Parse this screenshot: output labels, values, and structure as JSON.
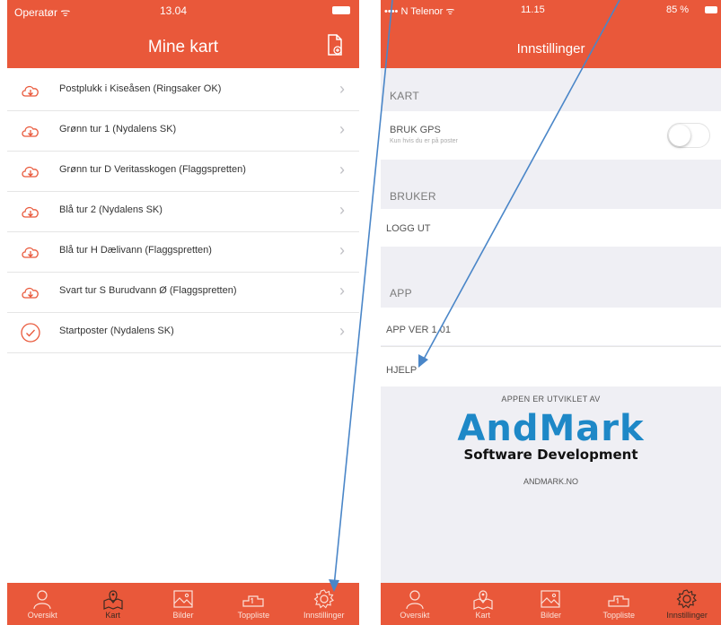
{
  "left_screen": {
    "status": {
      "carrier": "Operatør ᯤ",
      "time": "13.04"
    },
    "title": "Mine kart",
    "new_map_icon": "new-document-icon",
    "rows": [
      {
        "label": "Postplukk i Kiseåsen (Ringsaker OK)",
        "icon": "cloud-download-icon"
      },
      {
        "label": "Grønn tur 1 (Nydalens SK)",
        "icon": "cloud-download-icon"
      },
      {
        "label": "Grønn tur D Veritasskogen (Flaggspretten)",
        "icon": "cloud-download-icon"
      },
      {
        "label": "Blå tur 2 (Nydalens SK)",
        "icon": "cloud-download-icon"
      },
      {
        "label": "Blå tur H Dælivann (Flaggspretten)",
        "icon": "cloud-download-icon"
      },
      {
        "label": "Svart tur S Burudvann Ø (Flaggspretten)",
        "icon": "cloud-download-icon"
      },
      {
        "label": "Startposter (Nydalens SK)",
        "icon": "check-circle-icon"
      }
    ],
    "chevron": "›",
    "tabs": [
      {
        "label": "Oversikt",
        "icon": "person-icon"
      },
      {
        "label": "Kart",
        "icon": "map-pin-icon"
      },
      {
        "label": "Bilder",
        "icon": "image-icon"
      },
      {
        "label": "Toppliste",
        "icon": "podium-icon"
      },
      {
        "label": "Innstillinger",
        "icon": "gear-icon"
      }
    ]
  },
  "right_screen": {
    "status": {
      "carrier": "•••• N Telenor ᯤ",
      "time": "11.15",
      "battery": "85 %"
    },
    "title": "Innstillinger",
    "sections": {
      "kart": "KART",
      "bruker": "BRUKER",
      "app": "APP"
    },
    "gps": {
      "label": "BRUK GPS",
      "sub": "Kun hvis du er på poster"
    },
    "logout": "LOGG UT",
    "version": "APP VER 1.01",
    "help": "HJELP",
    "brand": {
      "caption": "APPEN ER UTVIKLET AV",
      "logo_main": "AndMark",
      "logo_sub": "Software Development",
      "url": "ANDMARK.NO"
    },
    "tabs": [
      {
        "label": "Oversikt",
        "icon": "person-icon"
      },
      {
        "label": "Kart",
        "icon": "map-pin-icon"
      },
      {
        "label": "Bilder",
        "icon": "image-icon"
      },
      {
        "label": "Toppliste",
        "icon": "podium-icon"
      },
      {
        "label": "Innstillinger",
        "icon": "gear-icon"
      }
    ]
  },
  "colors": {
    "accent": "#e9583a",
    "arrow": "#4a86c8",
    "brand_blue": "#1e88c7",
    "grouped_bg": "#efeff4"
  }
}
